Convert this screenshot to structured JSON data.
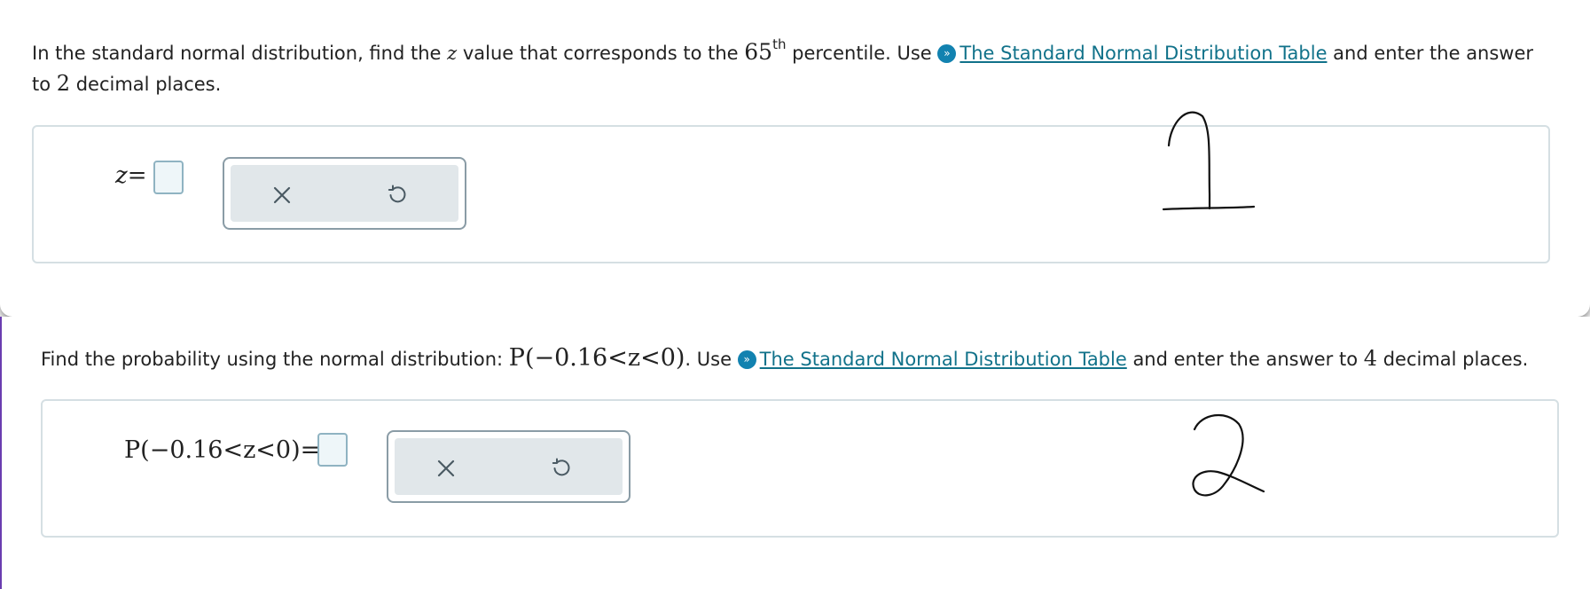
{
  "q1": {
    "t1": "In the standard normal distribution, find the ",
    "zvar": "z",
    "t2": " value that corresponds to the ",
    "num": "65",
    "sup": "th",
    "t3": " percentile. Use ",
    "link": "The Standard Normal Distribution Table",
    "t4": " and enter the answer",
    "t5": "to ",
    "dec": "2",
    "t6": " decimal places.",
    "lhs_var": "z",
    "lhs_eq": "=",
    "answer": "",
    "clear_icon": "x-icon",
    "undo_icon": "undo-icon",
    "scribble": "1"
  },
  "q2": {
    "t1": "Find the probability using the normal distribution: ",
    "expr": "P(−0.16<z<0)",
    "t2": ". Use ",
    "link": "The Standard Normal Distribution Table",
    "t3": " and enter the answer to ",
    "dec": "4",
    "t4": " decimal places.",
    "lhs": "P(−0.16<z<0)=",
    "answer": "",
    "clear_icon": "x-icon",
    "undo_icon": "undo-icon",
    "scribble": "2"
  },
  "colors": {
    "link": "#11728a",
    "help_icon": "#1282b0",
    "accent_border": "#8fb3c2"
  }
}
